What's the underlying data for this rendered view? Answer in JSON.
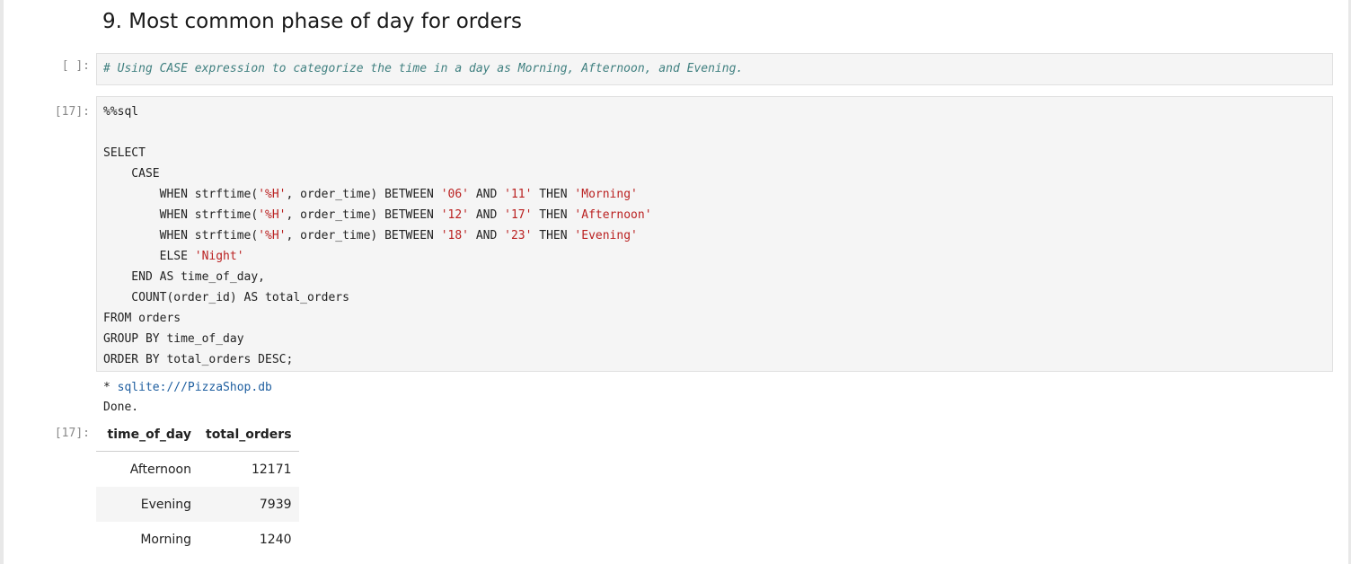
{
  "heading": "9. Most common phase of day for orders",
  "cells": [
    {
      "prompt": "[ ]:",
      "comment": "# Using CASE expression to categorize the time in a day as Morning, Afternoon, and Evening."
    },
    {
      "prompt": "[17]:",
      "code_lines": [
        "%%sql",
        "",
        "SELECT",
        "    CASE",
        "        WHEN strftime('%H', order_time) BETWEEN '06' AND '11' THEN 'Morning'",
        "        WHEN strftime('%H', order_time) BETWEEN '12' AND '17' THEN 'Afternoon'",
        "        WHEN strftime('%H', order_time) BETWEEN '18' AND '23' THEN 'Evening'",
        "        ELSE 'Night'",
        "    END AS time_of_day,",
        "    COUNT(order_id) AS total_orders",
        "FROM orders",
        "GROUP BY time_of_day",
        "ORDER BY total_orders DESC;"
      ]
    }
  ],
  "output": {
    "db_line_prefix": " * ",
    "db_line": "sqlite:///PizzaShop.db",
    "done": "Done.",
    "prompt": "[17]:",
    "table": {
      "headers": [
        "time_of_day",
        "total_orders"
      ],
      "rows": [
        [
          "Afternoon",
          "12171"
        ],
        [
          "Evening",
          "7939"
        ],
        [
          "Morning",
          "1240"
        ]
      ]
    }
  },
  "colors": {
    "comment": "#408080",
    "string": "#ba2121",
    "cell_bg": "#f5f5f5",
    "prompt": "#8a8a8a"
  }
}
